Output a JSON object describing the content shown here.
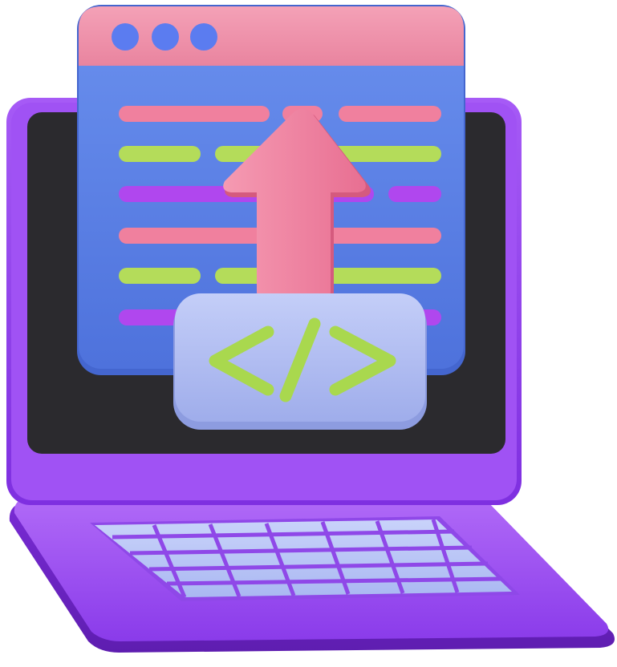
{
  "illustration": {
    "subject": "laptop-code-upload-icon",
    "colors": {
      "window_header": "#EE8FA8",
      "window_body": "#5F86E8",
      "window_dot": "#5B7CF0",
      "line_pink": "#F0809E",
      "line_green": "#B4DC5A",
      "line_purple": "#B047EE",
      "arrow": "#F07E9C",
      "code_badge": "#B7C2F4",
      "code_glyph": "#A9D84E",
      "laptop_body": "#9A42F2",
      "screen": "#2B2A2E",
      "keyboard_keys": "#B9C6F8"
    },
    "icons": [
      "browser-window-icon",
      "upload-arrow-icon",
      "code-brackets-icon",
      "laptop-icon",
      "keyboard-icon"
    ]
  }
}
